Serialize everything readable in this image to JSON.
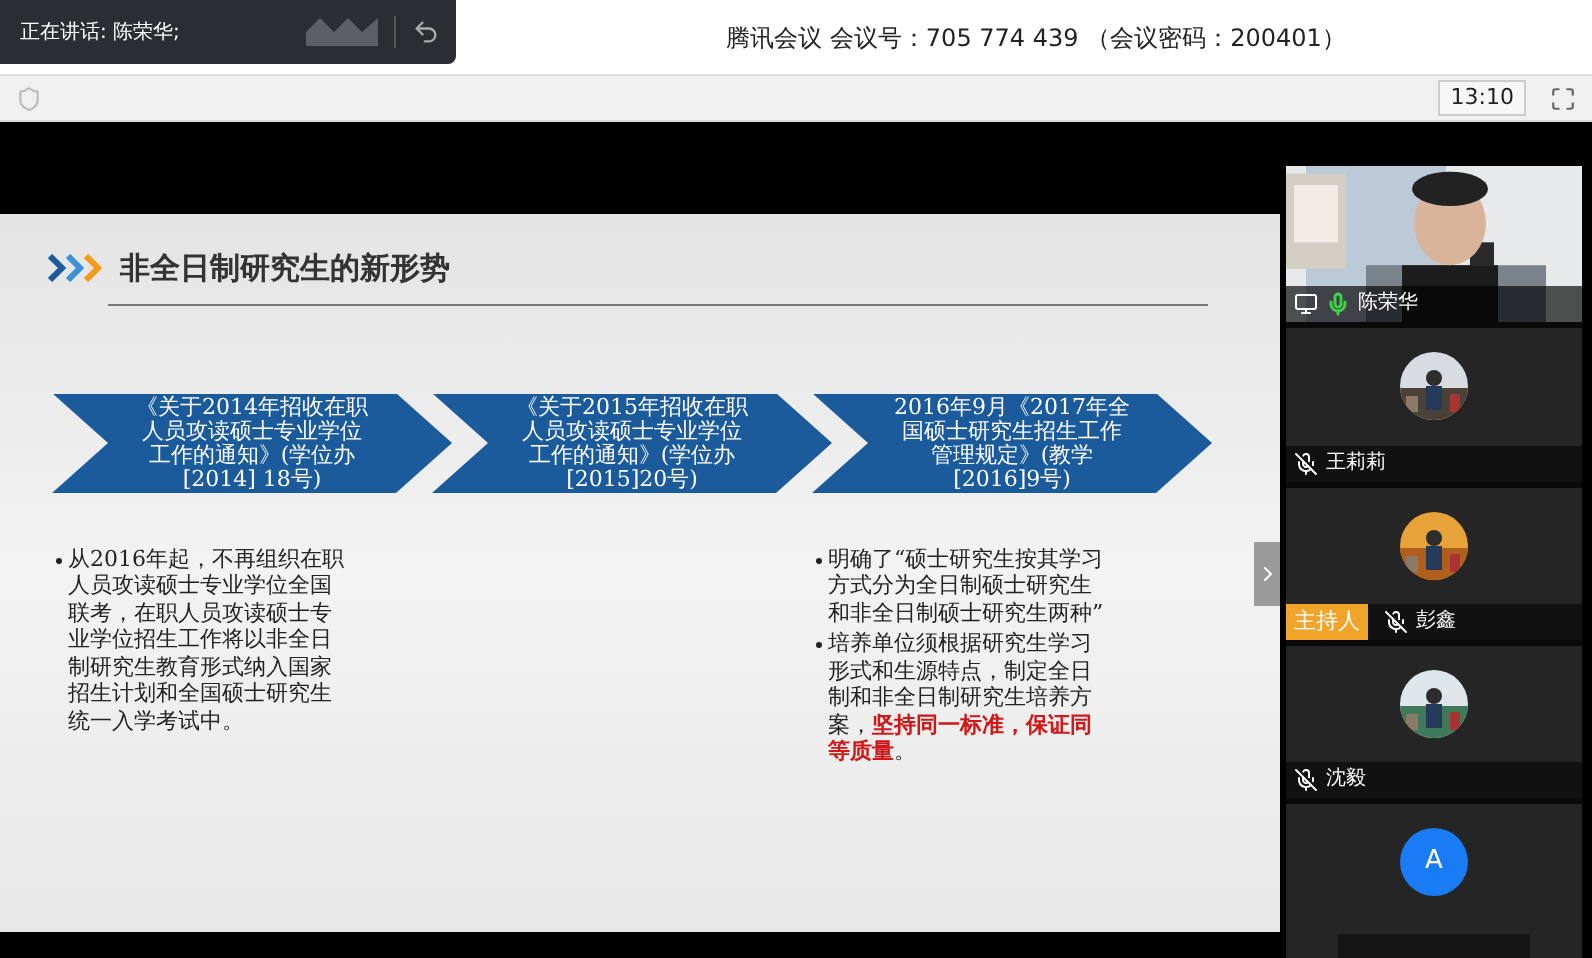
{
  "speaking_toast": {
    "label": "正在讲话: 陈荣华;"
  },
  "meeting_title": "腾讯会议 会议号：705 774 439 （会议密码：200401）",
  "clock": "13:10",
  "slide": {
    "title": "非全日制研究生的新形势",
    "steps": [
      {
        "heading": "《关于2014年招收在职人员攻读硕士专业学位工作的通知》(学位办[2014] 18号)",
        "bullets": [
          [
            {
              "text": "从2016年起，不再组织在职人员攻读硕士专业学位全国联考，在职人员攻读硕士专业学位招生工作将以非全日制研究生教育形式纳入国家招生计划和全国硕士研究生统一入学考试中。",
              "emphasis": false
            }
          ]
        ]
      },
      {
        "heading": "《关于2015年招收在职人员攻读硕士专业学位工作的通知》(学位办[2015]20号)"
      },
      {
        "heading": "2016年9月《2017年全国硕士研究生招生工作管理规定》(教学[2016]9号)",
        "bullets": [
          [
            {
              "text": "明确了“硕士研究生按其学习方式分为全日制硕士研究生和非全日制硕士研究生两种”",
              "emphasis": false
            }
          ],
          [
            {
              "text": "培养单位须根据研究生学习形式和生源特点，制定全日制和非全日制研究生培养方案，",
              "emphasis": false
            },
            {
              "text": "坚持同一标准，保证同等质量",
              "emphasis": true
            },
            {
              "text": "。",
              "emphasis": false
            }
          ]
        ]
      }
    ]
  },
  "participants": [
    {
      "kind": "video",
      "name": "陈荣华",
      "muted": false,
      "sharing": true
    },
    {
      "name": "王莉莉",
      "muted": true
    },
    {
      "name": "彭鑫",
      "muted": true,
      "host": true,
      "badge": "主持人"
    },
    {
      "name": "沈毅",
      "muted": true
    },
    {
      "kind": "initial",
      "initial": "A"
    }
  ]
}
